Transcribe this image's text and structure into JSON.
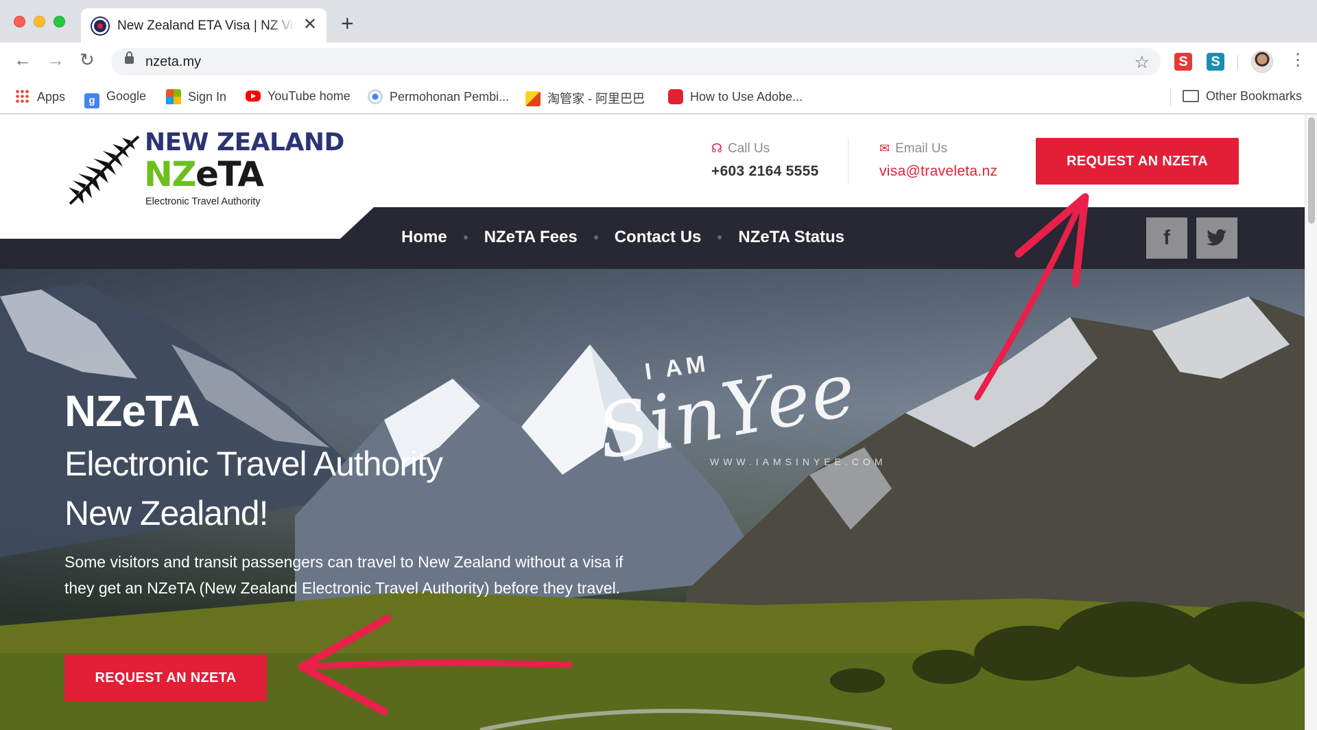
{
  "browser": {
    "tab_title": "New Zealand ETA Visa | NZ Visa Online",
    "url": "nzeta.my",
    "bookmarks": [
      {
        "label": "Apps",
        "icon": "apps-grid-icon"
      },
      {
        "label": "Google",
        "icon": "google-icon"
      },
      {
        "label": "Sign In",
        "icon": "microsoft-icon"
      },
      {
        "label": "YouTube home",
        "icon": "youtube-icon"
      },
      {
        "label": "Permohonan Pembi...",
        "icon": "chrome-icon"
      },
      {
        "label": "淘管家 - 阿里巴巴",
        "icon": "taobao-icon"
      },
      {
        "label": "How to Use Adobe...",
        "icon": "adobe-icon"
      }
    ],
    "other_bookmarks": "Other Bookmarks",
    "extensions": [
      "S",
      "S"
    ]
  },
  "site": {
    "logo": {
      "line1": "NEW ZEALAND",
      "nz": "NZ",
      "eta": "eTA",
      "subtitle": "Electronic Travel Authority"
    },
    "call": {
      "label": "Call Us",
      "value": "+603 2164 5555"
    },
    "email": {
      "label": "Email Us",
      "value": "visa@traveleta.nz"
    },
    "cta_top": "REQUEST AN NZETA",
    "menu": [
      "Home",
      "NZeTA Fees",
      "Contact Us",
      "NZeTA Status"
    ],
    "social": {
      "facebook": "f",
      "twitter": "t"
    }
  },
  "hero": {
    "title": "NZeTA",
    "subtitle_line1": "Electronic Travel Authority",
    "subtitle_line2": "New Zealand!",
    "description": "Some visitors and transit passengers can travel to New Zealand without a visa if they get an NZeTA (New Zealand Electronic Travel Authority) before they travel.",
    "cta": "REQUEST AN NZETA"
  },
  "watermark": {
    "iam": "I AM",
    "name": "SinYee",
    "url": "WWW.IAMSINYEE.COM"
  },
  "colors": {
    "brand_red": "#e21f36",
    "brand_navy": "#2b3474",
    "brand_green": "#6cbf1e",
    "nav_dark": "#272833",
    "annotation_arrow": "#e8204a"
  }
}
